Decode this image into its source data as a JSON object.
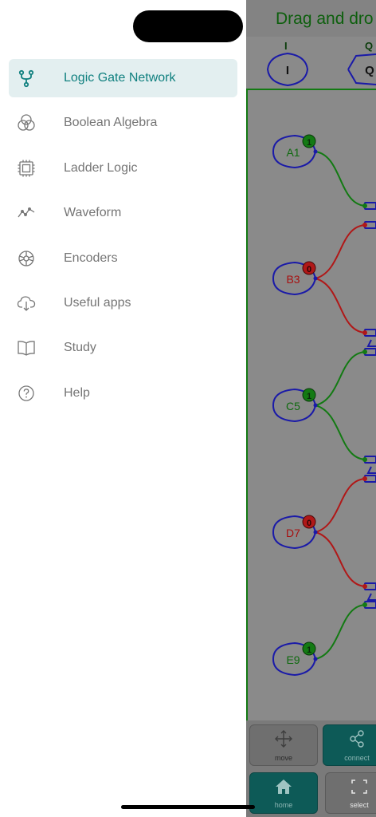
{
  "background_app": {
    "header_title": "Drag and dro",
    "io": [
      {
        "label": "I",
        "pin": "I"
      },
      {
        "label": "Q",
        "pin": "Q"
      }
    ],
    "inputs": [
      {
        "name": "A1",
        "state": "1"
      },
      {
        "name": "B3",
        "state": "0"
      },
      {
        "name": "C5",
        "state": "1"
      },
      {
        "name": "D7",
        "state": "0"
      },
      {
        "name": "E9",
        "state": "1"
      }
    ],
    "toolbar": {
      "move": "move",
      "connect": "connect",
      "home": "home",
      "select": "select"
    }
  },
  "drawer": {
    "items": [
      {
        "label": "Logic Gate Network",
        "icon": "network-icon",
        "active": true
      },
      {
        "label": "Boolean Algebra",
        "icon": "venn-icon"
      },
      {
        "label": "Ladder Logic",
        "icon": "chip-icon"
      },
      {
        "label": "Waveform",
        "icon": "waveform-icon"
      },
      {
        "label": "Encoders",
        "icon": "encoder-icon"
      },
      {
        "label": "Useful apps",
        "icon": "cloud-download-icon"
      },
      {
        "label": "Study",
        "icon": "book-icon"
      },
      {
        "label": "Help",
        "icon": "help-icon"
      }
    ]
  },
  "colors": {
    "accent": "#10807f",
    "active_bg": "#e3eff0",
    "wire_high": "#137a13",
    "wire_low": "#b01818",
    "gate_outline": "#1a1aa8"
  }
}
